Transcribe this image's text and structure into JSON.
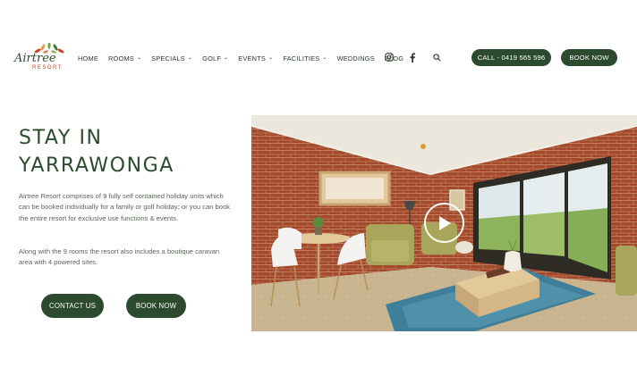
{
  "brand": {
    "name": "Airtree",
    "subtitle": "RESORT"
  },
  "nav": {
    "items": [
      {
        "label": "HOME",
        "dropdown": false
      },
      {
        "label": "ROOMS",
        "dropdown": true
      },
      {
        "label": "SPECIALS",
        "dropdown": true
      },
      {
        "label": "GOLF",
        "dropdown": true
      },
      {
        "label": "EVENTS",
        "dropdown": true
      },
      {
        "label": "FACILITIES",
        "dropdown": true
      },
      {
        "label": "WEDDINGS",
        "dropdown": false
      },
      {
        "label": "BLOG",
        "dropdown": false
      }
    ],
    "social_icons": [
      "instagram-icon",
      "facebook-icon"
    ],
    "search_icon": "search-icon"
  },
  "header_buttons": {
    "call": "CALL - 0419 565 596",
    "book": "BOOK NOW"
  },
  "hero": {
    "title_line1": "STAY IN",
    "title_line2": "YARRAWONGA",
    "paragraph1": "Airtree Resort comprises of 9 fully self contained holiday units which can be booked individually for a family or golf holiday; or you can book the entire resort for exclusive use functions & events.",
    "paragraph2": "Along with the 9 rooms the resort also includes a boutique caravan area with 4 powered sites.",
    "contact_button": "CONTACT US",
    "book_button": "BOOK NOW"
  },
  "media": {
    "play_icon": "play-icon"
  },
  "colors": {
    "brand_green": "#2c4a2d",
    "text": "#5a6458",
    "logo_accent": "#c0492b"
  }
}
